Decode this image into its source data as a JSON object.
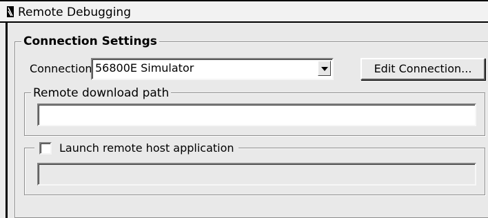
{
  "window": {
    "title": "Remote Debugging",
    "icon": "document-icon"
  },
  "connection_settings": {
    "title": "Connection Settings",
    "connection_label": "Connection:",
    "connection_value": "56800E Simulator",
    "edit_button_label": "Edit Connection..."
  },
  "remote_download": {
    "title": "Remote download path",
    "value": ""
  },
  "launch_remote": {
    "label": "Launch remote host application",
    "checked": false,
    "value": ""
  }
}
